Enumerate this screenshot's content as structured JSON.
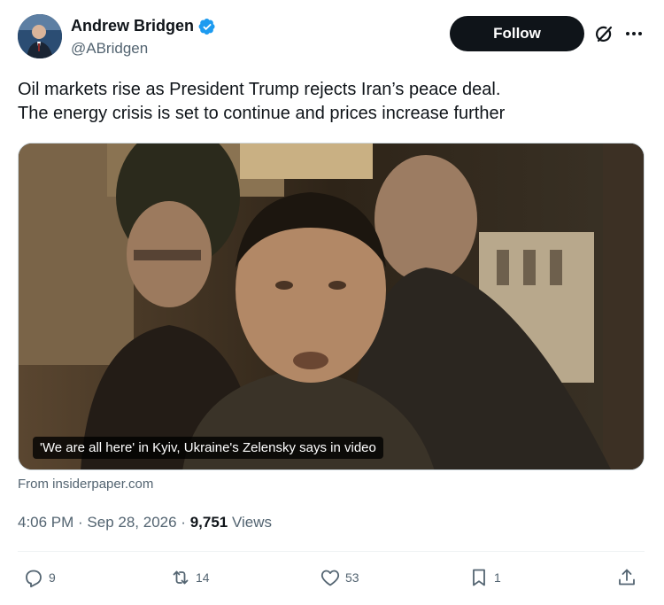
{
  "author": {
    "display_name": "Andrew Bridgen",
    "handle": "@ABridgen",
    "verified_color": "#1d9bf0"
  },
  "follow_label": "Follow",
  "icons": {
    "grok": "grok-icon",
    "more": "more-icon"
  },
  "tweet": {
    "line1": "Oil markets rise as President Trump rejects Iran’s peace deal.",
    "line2": "The energy crisis is set to continue and prices increase further"
  },
  "media": {
    "caption": "'We are all here' in Kyiv, Ukraine's Zelensky says in video"
  },
  "source": "From insiderpaper.com",
  "meta": {
    "time": "4:06 PM",
    "sep1": " · ",
    "date": "Sep 28, 2026",
    "sep2": " · ",
    "views_count": "9,751",
    "views_label": " Views"
  },
  "actions": {
    "replies": "9",
    "reposts": "14",
    "likes": "53",
    "bookmarks": "1"
  }
}
